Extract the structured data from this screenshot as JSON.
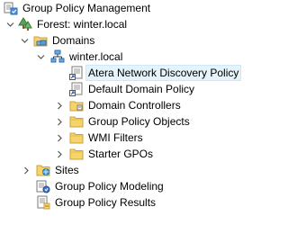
{
  "tree": {
    "root": {
      "label": "Group Policy Management",
      "icon": "gpmc-console-icon",
      "expanded": true
    },
    "forest": {
      "label": "Forest: winter.local",
      "icon": "forest-icon",
      "expanded": true
    },
    "domains": {
      "label": "Domains",
      "icon": "domains-folder-icon",
      "expanded": true
    },
    "domain": {
      "label": "winter.local",
      "icon": "domain-icon",
      "expanded": true
    },
    "domain_children": [
      {
        "label": "Atera Network Discovery Policy",
        "icon": "gpo-link-icon",
        "selected": true,
        "expandable": false
      },
      {
        "label": "Default Domain Policy",
        "icon": "gpo-link-icon",
        "selected": false,
        "expandable": false
      },
      {
        "label": "Domain Controllers",
        "icon": "ou-folder-icon",
        "selected": false,
        "expandable": true
      },
      {
        "label": "Group Policy Objects",
        "icon": "folder-icon",
        "selected": false,
        "expandable": true
      },
      {
        "label": "WMI Filters",
        "icon": "folder-icon",
        "selected": false,
        "expandable": true
      },
      {
        "label": "Starter GPOs",
        "icon": "folder-icon",
        "selected": false,
        "expandable": true
      }
    ],
    "sites": {
      "label": "Sites",
      "icon": "sites-icon",
      "expandable": true
    },
    "modeling": {
      "label": "Group Policy Modeling",
      "icon": "modeling-icon"
    },
    "results": {
      "label": "Group Policy Results",
      "icon": "results-icon"
    }
  },
  "colors": {
    "selection_bg": "#e5f3fb",
    "selection_border": "#cde8f7",
    "folder_yellow": "#f6d36b",
    "twisty": "#555555"
  }
}
